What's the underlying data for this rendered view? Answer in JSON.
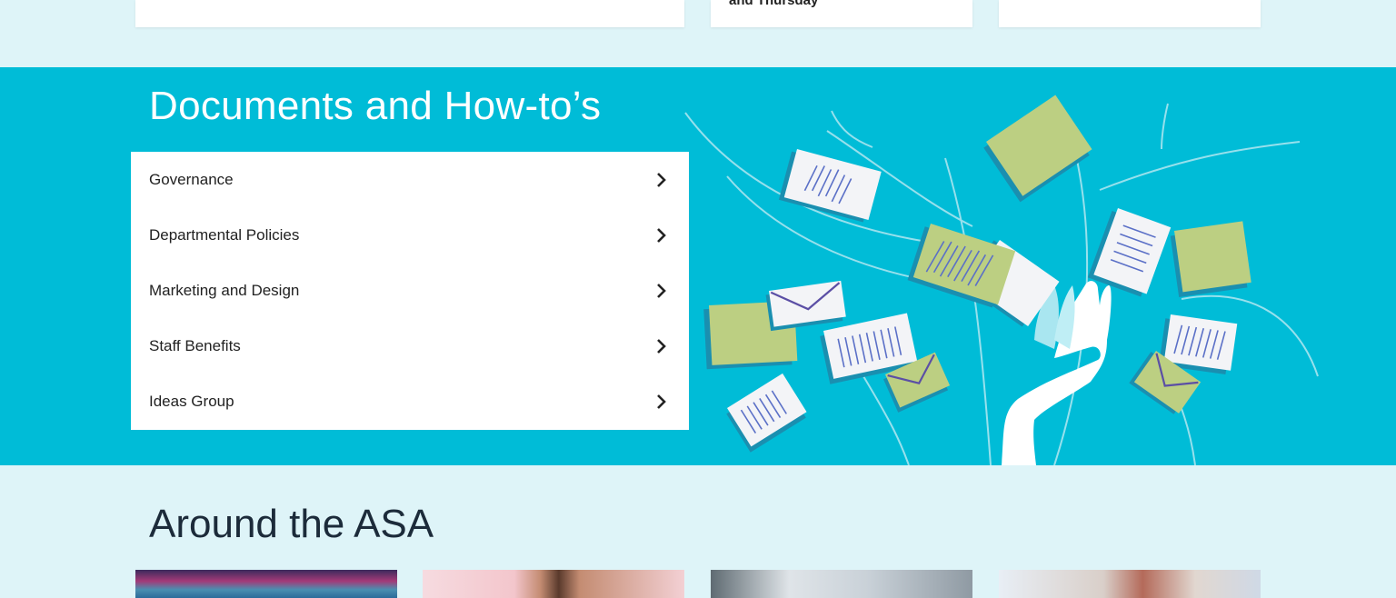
{
  "top_cards": {
    "card2_text": "and Thursday"
  },
  "documents": {
    "title": "Documents and How-to’s",
    "items": [
      {
        "label": "Governance"
      },
      {
        "label": "Departmental Policies"
      },
      {
        "label": "Marketing and Design"
      },
      {
        "label": "Staff Benefits"
      },
      {
        "label": "Ideas Group"
      }
    ],
    "chevron_icon": "chevron-right-icon",
    "illustration": "hand-releasing-documents-illustration"
  },
  "around": {
    "title": "Around the ASA",
    "thumbnails": [
      "swimming-pool-photo",
      "swimmer-diving-photo",
      "outdoor-swimmers-photo",
      "swimming-event-photo"
    ]
  },
  "colors": {
    "accent": "#00bcd7",
    "background": "#def4f8",
    "paper_green": "#bccf82",
    "paper_white": "#f3f4f7",
    "line_purple": "#5b4fa5"
  }
}
